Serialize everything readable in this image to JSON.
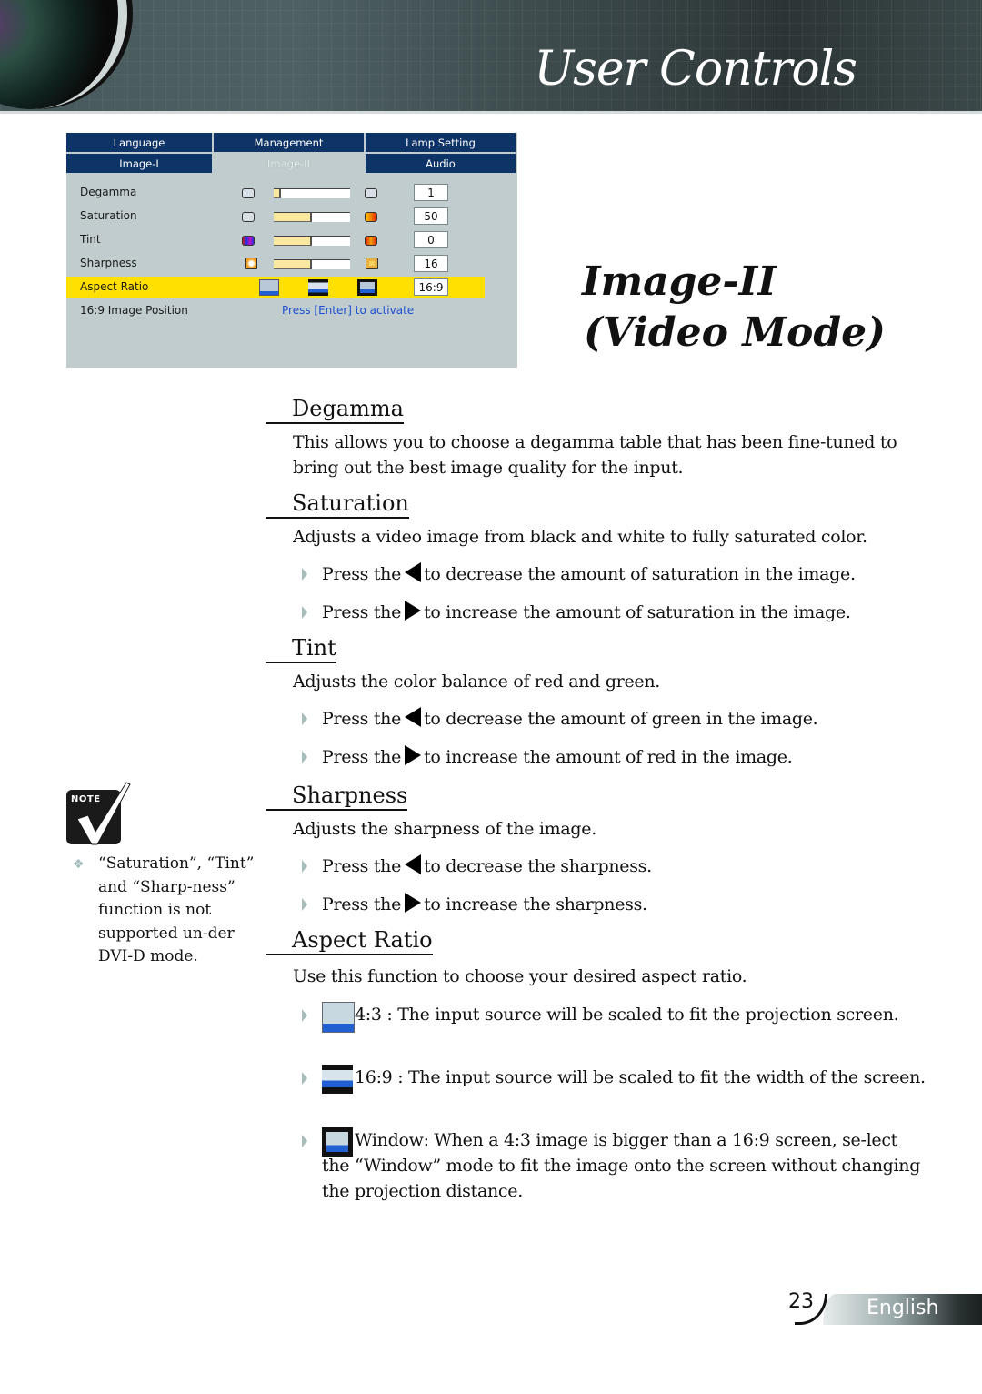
{
  "header": {
    "title": "User Controls"
  },
  "osd": {
    "tabs_row1": [
      "Language",
      "Management",
      "Lamp Setting"
    ],
    "tabs_row2": [
      "Image-I",
      "Image-II",
      "Audio"
    ],
    "active_tab": "Image-II",
    "rows": [
      {
        "label": "Degamma",
        "value": "1",
        "level": 0.1
      },
      {
        "label": "Saturation",
        "value": "50",
        "level": 0.5
      },
      {
        "label": "Tint",
        "value": "0",
        "level": 0.5
      },
      {
        "label": "Sharpness",
        "value": "16",
        "level": 0.5
      }
    ],
    "aspect_ratio": {
      "label": "Aspect Ratio",
      "value": "16:9",
      "options": [
        "4:3",
        "16:9",
        "Window"
      ]
    },
    "image_position": {
      "label": "16:9 Image Position",
      "action": "Press [Enter] to activate"
    },
    "colors": {
      "tab_bg": "#0e3366",
      "panel_bg": "#c0cccd",
      "highlight": "#ffe000",
      "link": "#1f4fd0"
    }
  },
  "title": {
    "main": "Image-II",
    "sub": "(Video Mode)"
  },
  "sections": {
    "degamma": {
      "heading": "Degamma",
      "text": "This allows you to choose a degamma table that has been fine-tuned to bring out the best image quality for the input."
    },
    "saturation": {
      "heading": "Saturation",
      "text": "Adjusts a video image from black and white to fully saturated color.",
      "bullets": [
        {
          "pre": "Press the",
          "post": "to decrease the amount of saturation in the image.",
          "arrow": "left"
        },
        {
          "pre": "Press the",
          "post": "to increase the amount of saturation in the image.",
          "arrow": "right"
        }
      ]
    },
    "tint": {
      "heading": "Tint",
      "text": "Adjusts the color balance of red and green.",
      "bullets": [
        {
          "pre": "Press the",
          "post": "to decrease the amount of green in the image.",
          "arrow": "left"
        },
        {
          "pre": "Press the",
          "post": "to increase the amount of red in the image.",
          "arrow": "right"
        }
      ]
    },
    "sharpness": {
      "heading": "Sharpness",
      "text": "Adjusts the sharpness of the image.",
      "bullets": [
        {
          "pre": "Press the",
          "post": "to decrease the sharpness.",
          "arrow": "left"
        },
        {
          "pre": "Press the",
          "post": "to increase the sharpness.",
          "arrow": "right"
        }
      ]
    },
    "aspect_ratio": {
      "heading": "Aspect Ratio",
      "text": "Use this function to choose your desired aspect ratio.",
      "bullets": [
        {
          "icon": "aspect-4-3-icon",
          "text": "4:3 : The input source will be scaled to fit the projection screen."
        },
        {
          "icon": "aspect-16-9-icon",
          "text": "16:9 : The input source will be scaled to fit the width of the screen."
        },
        {
          "icon": "aspect-window-icon",
          "text": "Window: When a 4:3 image is bigger than a 16:9 screen, se-lect the “Window” mode to fit the image onto the screen without changing the projection distance."
        }
      ]
    }
  },
  "note": {
    "label": "NOTE",
    "bullet": "❖",
    "text": "“Saturation”, “Tint” and “Sharp-ness” function is not supported un-der DVI-D mode."
  },
  "footer": {
    "page_number": "23",
    "language": "English"
  }
}
